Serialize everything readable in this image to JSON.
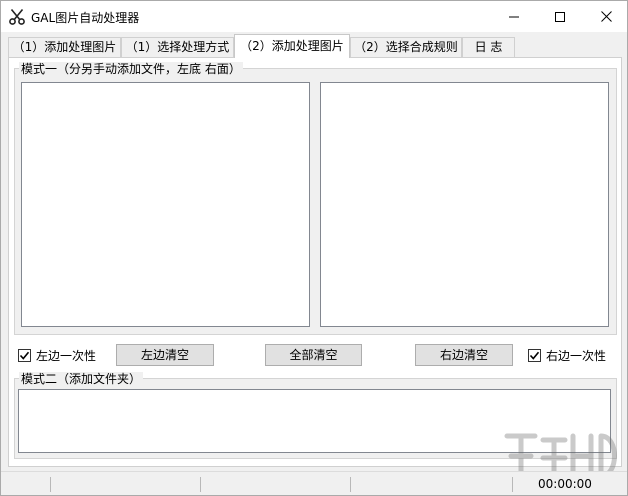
{
  "window": {
    "title": "GAL图片自动处理器",
    "icon": "scissors-icon"
  },
  "titlebar_buttons": {
    "minimize": "minimize-icon",
    "maximize": "maximize-icon",
    "close": "close-icon"
  },
  "tabs": [
    {
      "label": "（1）添加处理图片",
      "active": false
    },
    {
      "label": "（1）选择处理方式",
      "active": false
    },
    {
      "label": "（2）添加处理图片",
      "active": true
    },
    {
      "label": "（2）选择合成规则",
      "active": false
    },
    {
      "label": "日 志",
      "active": false
    }
  ],
  "mode1": {
    "legend": "模式一（分另手动添加文件，左底 右面）",
    "left_checkbox": {
      "label": "左边一次性",
      "checked": true
    },
    "left_clear_button": "左边清空",
    "clear_all_button": "全部清空",
    "right_clear_button": "右边清空",
    "right_checkbox": {
      "label": "右边一次性",
      "checked": true
    }
  },
  "mode2": {
    "legend": "模式二（添加文件夹）"
  },
  "statusbar": {
    "time": "00:00:00"
  }
}
